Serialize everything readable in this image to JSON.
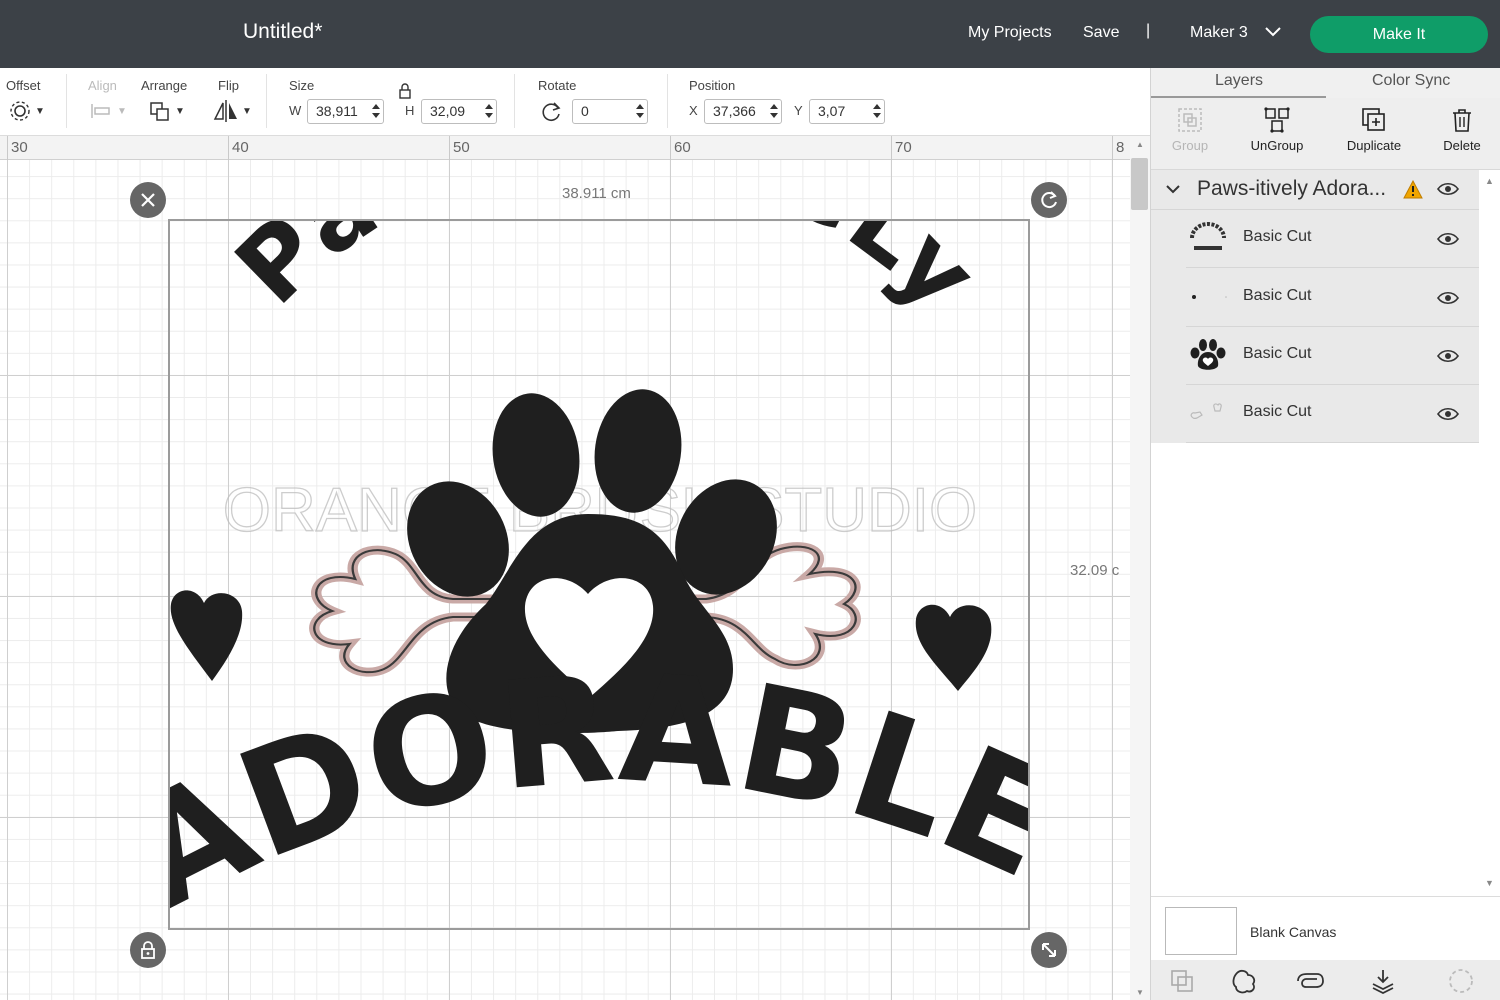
{
  "header": {
    "doc_title": "Untitled*",
    "my_projects": "My Projects",
    "save": "Save",
    "separator": "|",
    "machine": "Maker 3",
    "make_it": "Make It"
  },
  "toolbar": {
    "offset_label": "Offset",
    "align_label": "Align",
    "arrange_label": "Arrange",
    "flip_label": "Flip",
    "size_label": "Size",
    "width_letter": "W",
    "width_value": "38,911",
    "height_letter": "H",
    "height_value": "32,09",
    "rotate_label": "Rotate",
    "rotate_value": "0",
    "position_label": "Position",
    "x_letter": "X",
    "x_value": "37,366",
    "y_letter": "Y",
    "y_value": "3,07"
  },
  "ruler": {
    "labels": [
      "30",
      "40",
      "50",
      "60",
      "70",
      "8"
    ]
  },
  "canvas": {
    "width_dimension": "38.911 cm",
    "height_dimension": "32.09 c"
  },
  "artwork": {
    "top_text": "Paws-iTiVeLy",
    "bottom_text": "ADORABLE",
    "watermark": "ORANGE BRUSH STUDIO"
  },
  "panel": {
    "tabs": [
      "Layers",
      "Color Sync"
    ],
    "actions": {
      "group": "Group",
      "ungroup": "UnGroup",
      "duplicate": "Duplicate",
      "delete": "Delete"
    },
    "group_name": "Paws-itively Adora...",
    "layers": [
      {
        "label": "Basic Cut",
        "thumb": "text-thumbnail"
      },
      {
        "label": "Basic Cut",
        "thumb": "dot-thumbnail"
      },
      {
        "label": "Basic Cut",
        "thumb": "paw-thumbnail"
      },
      {
        "label": "Basic Cut",
        "thumb": "bone-thumbnail"
      }
    ],
    "blank_canvas": "Blank Canvas"
  },
  "colors": {
    "topbar": "#3c4147",
    "make_it": "#0f9d68",
    "ink": "#1f1f1f",
    "bone_outline": "#c9a9a6",
    "warning": "#f0a500"
  }
}
